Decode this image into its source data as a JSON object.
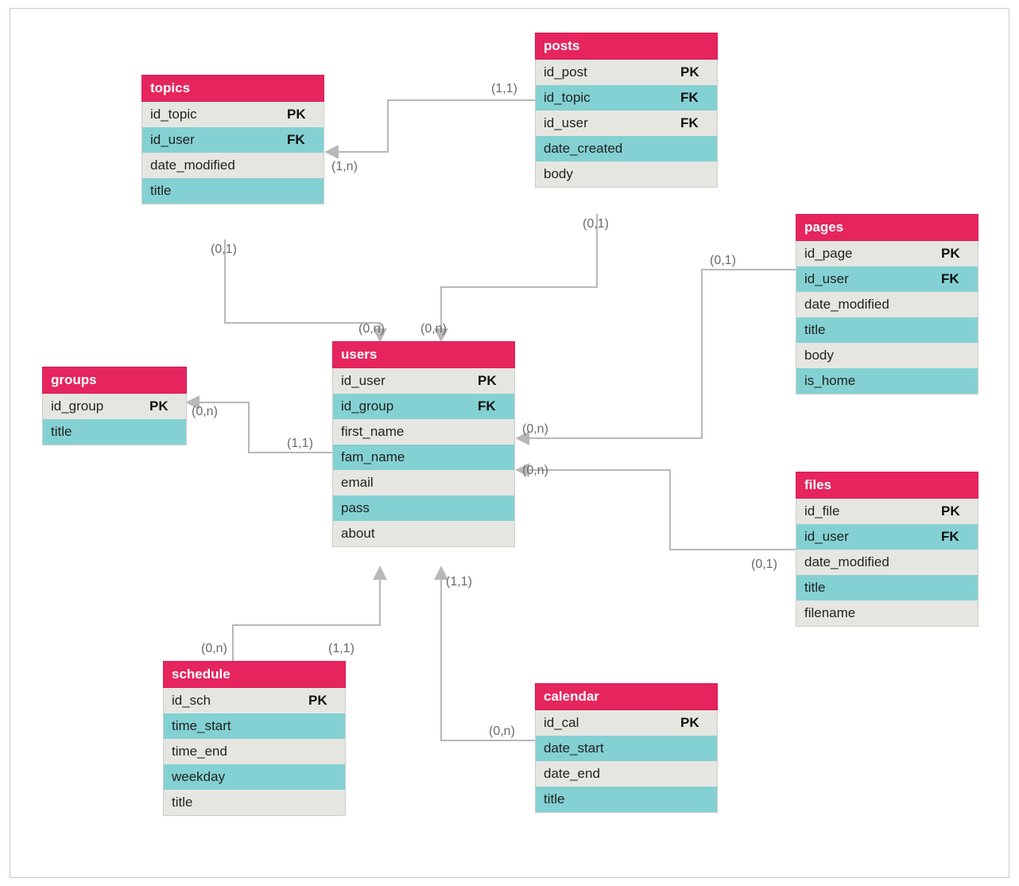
{
  "tables": {
    "topics": {
      "title": "topics",
      "rows": [
        {
          "name": "id_topic",
          "key": "PK"
        },
        {
          "name": "id_user",
          "key": "FK"
        },
        {
          "name": "date_modified",
          "key": ""
        },
        {
          "name": "title",
          "key": ""
        }
      ]
    },
    "posts": {
      "title": "posts",
      "rows": [
        {
          "name": "id_post",
          "key": "PK"
        },
        {
          "name": "id_topic",
          "key": "FK"
        },
        {
          "name": "id_user",
          "key": "FK"
        },
        {
          "name": "date_created",
          "key": ""
        },
        {
          "name": "body",
          "key": ""
        }
      ]
    },
    "pages": {
      "title": "pages",
      "rows": [
        {
          "name": "id_page",
          "key": "PK"
        },
        {
          "name": "id_user",
          "key": "FK"
        },
        {
          "name": "date_modified",
          "key": ""
        },
        {
          "name": "title",
          "key": ""
        },
        {
          "name": "body",
          "key": ""
        },
        {
          "name": "is_home",
          "key": ""
        }
      ]
    },
    "groups": {
      "title": "groups",
      "rows": [
        {
          "name": "id_group",
          "key": "PK"
        },
        {
          "name": "title",
          "key": ""
        }
      ]
    },
    "users": {
      "title": "users",
      "rows": [
        {
          "name": "id_user",
          "key": "PK"
        },
        {
          "name": "id_group",
          "key": "FK"
        },
        {
          "name": "first_name",
          "key": ""
        },
        {
          "name": "fam_name",
          "key": ""
        },
        {
          "name": "email",
          "key": ""
        },
        {
          "name": "pass",
          "key": ""
        },
        {
          "name": "about",
          "key": ""
        }
      ]
    },
    "files": {
      "title": "files",
      "rows": [
        {
          "name": "id_file",
          "key": "PK"
        },
        {
          "name": "id_user",
          "key": "FK"
        },
        {
          "name": "date_modified",
          "key": ""
        },
        {
          "name": "title",
          "key": ""
        },
        {
          "name": "filename",
          "key": ""
        }
      ]
    },
    "schedule": {
      "title": "schedule",
      "rows": [
        {
          "name": "id_sch",
          "key": "PK"
        },
        {
          "name": "time_start",
          "key": ""
        },
        {
          "name": "time_end",
          "key": ""
        },
        {
          "name": "weekday",
          "key": ""
        },
        {
          "name": "title",
          "key": ""
        }
      ]
    },
    "calendar": {
      "title": "calendar",
      "rows": [
        {
          "name": "id_cal",
          "key": "PK"
        },
        {
          "name": "date_start",
          "key": ""
        },
        {
          "name": "date_end",
          "key": ""
        },
        {
          "name": "title",
          "key": ""
        }
      ]
    }
  },
  "cardinalities": {
    "c1": "(1,1)",
    "c2": "(1,n)",
    "c3": "(0,1)",
    "c4": "(0,1)",
    "c5": "(0,n)",
    "c6": "(0,n)",
    "c7": "(0,n)",
    "c8": "(1,1)",
    "c9": "(0,n)",
    "c10": "(0,1)",
    "c11": "(0,n)",
    "c12": "(0,1)",
    "c13": "(1,1)",
    "c14": "(0,n)",
    "c15": "(1,1)",
    "c16": "(0,n)"
  },
  "colors": {
    "header": "#e6255e",
    "rowA": "#e6e6e1",
    "rowB": "#84d1d3",
    "line": "#b8b8b8",
    "text_gray": "#6a6a6a"
  }
}
